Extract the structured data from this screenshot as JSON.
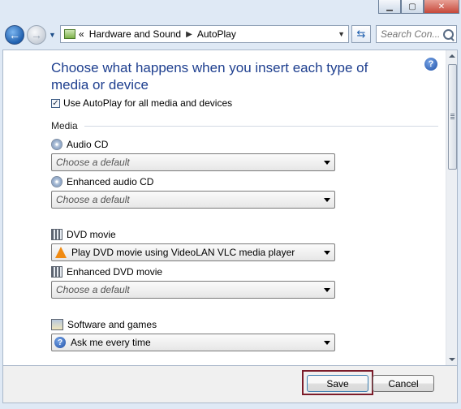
{
  "window": {
    "caption_buttons": [
      "minimize",
      "maximize",
      "close"
    ]
  },
  "toolbar": {
    "breadcrumb": [
      "Hardware and Sound",
      "AutoPlay"
    ],
    "overflow_glyph": "«",
    "search_placeholder": "Search Con...",
    "icons": [
      "back-arrow-icon",
      "forward-arrow-icon",
      "control-panel-icon",
      "refresh-icon",
      "search-icon"
    ]
  },
  "page": {
    "title": "Choose what happens when you insert each type of media or device",
    "autoplay_checkbox": {
      "label": "Use AutoPlay for all media and devices",
      "checked": true
    },
    "section": "Media",
    "items": [
      {
        "label": "Audio CD",
        "icon": "audio-cd-icon",
        "value": "Choose a default",
        "placeholder": true
      },
      {
        "label": "Enhanced audio CD",
        "icon": "enhanced-audio-cd-icon",
        "value": "Choose a default",
        "placeholder": true
      },
      {
        "label": "DVD movie",
        "icon": "dvd-movie-icon",
        "value": "Play DVD movie using VideoLAN VLC media player",
        "placeholder": false,
        "value_icon": "vlc-icon"
      },
      {
        "label": "Enhanced DVD movie",
        "icon": "enhanced-dvd-icon",
        "value": "Choose a default",
        "placeholder": true
      },
      {
        "label": "Software and games",
        "icon": "software-games-icon",
        "value": "Ask me every time",
        "placeholder": false,
        "value_icon": "ask-icon"
      }
    ]
  },
  "footer": {
    "save_label": "Save",
    "cancel_label": "Cancel",
    "focus_color": "#7b1c2a"
  }
}
